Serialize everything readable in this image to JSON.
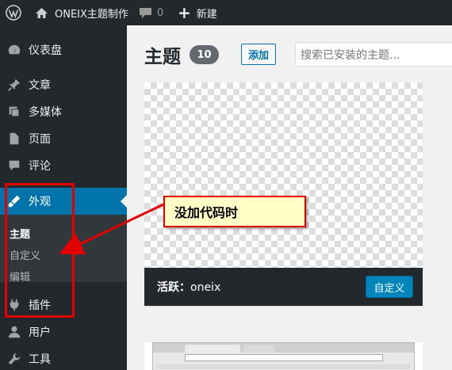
{
  "adminbar": {
    "site_name": "ONEIX主题制作",
    "comment_count": "0",
    "new_label": "新建"
  },
  "sidebar": {
    "items": [
      {
        "label": "仪表盘",
        "icon": "dashboard-icon"
      },
      {
        "label": "文章",
        "icon": "pin-icon"
      },
      {
        "label": "多媒体",
        "icon": "media-icon"
      },
      {
        "label": "页面",
        "icon": "page-icon"
      },
      {
        "label": "评论",
        "icon": "comment-icon"
      },
      {
        "label": "外观",
        "icon": "brush-icon"
      },
      {
        "label": "插件",
        "icon": "plugin-icon"
      },
      {
        "label": "用户",
        "icon": "user-icon"
      },
      {
        "label": "工具",
        "icon": "wrench-icon"
      }
    ],
    "submenu": [
      {
        "label": "主题"
      },
      {
        "label": "自定义"
      },
      {
        "label": "编辑"
      }
    ]
  },
  "main": {
    "title": "主题",
    "count": "10",
    "add_label": "添加",
    "search_placeholder": "搜索已安装的主题..."
  },
  "theme": {
    "active_prefix": "活跃：",
    "name": "oneix",
    "customize_label": "自定义"
  },
  "annotation": {
    "callout_text": "没加代码时"
  },
  "colors": {
    "adminbar_bg": "#23282d",
    "accent": "#0073aa",
    "annotation_red": "#e30000",
    "callout_bg": "#ffffc6"
  }
}
